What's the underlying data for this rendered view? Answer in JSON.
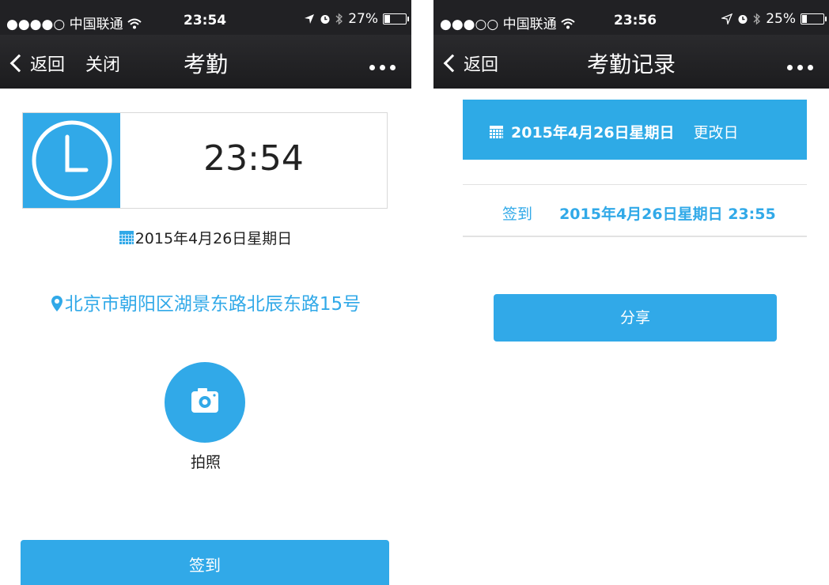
{
  "left_screen": {
    "status": {
      "signal": "●●●●○",
      "carrier": "中国联通",
      "time": "23:54",
      "battery": "27%",
      "battery_level": 0.27
    },
    "nav": {
      "back_label": "返回",
      "close_label": "关闭",
      "title": "考勤"
    },
    "clock_time": "23:54",
    "date": "2015年4月26日星期日",
    "address": "北京市朝阳区湖景东路北辰东路15号",
    "camera_label": "拍照",
    "sign_in_label": "签到"
  },
  "right_screen": {
    "status": {
      "signal": "●●●○○",
      "carrier": "中国联通",
      "time": "23:56",
      "battery": "25%",
      "battery_level": 0.25
    },
    "nav": {
      "back_label": "返回",
      "title": "考勤记录"
    },
    "date_bar": {
      "date": "2015年4月26日星期日",
      "change_label": "更改日"
    },
    "record": {
      "type": "签到",
      "datetime": "2015年4月26日星期日 23:55"
    },
    "share_label": "分享"
  },
  "colors": {
    "accent": "#31a9e8",
    "navbar": "#212124"
  },
  "icons": [
    "wifi-icon",
    "location-arrow-icon",
    "alarm-icon",
    "bluetooth-icon",
    "battery-icon",
    "back-chevron-icon",
    "more-icon",
    "clock-icon",
    "calendar-icon",
    "location-pin-icon",
    "camera-icon"
  ]
}
